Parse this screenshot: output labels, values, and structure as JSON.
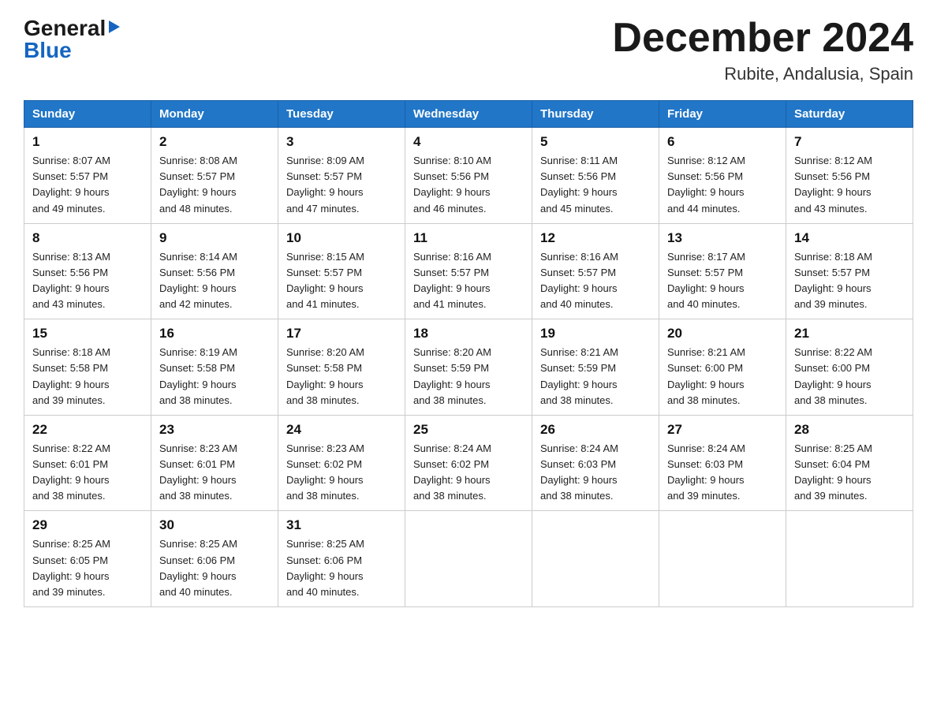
{
  "header": {
    "logo_line1": "General",
    "logo_line2": "Blue",
    "month_title": "December 2024",
    "location": "Rubite, Andalusia, Spain"
  },
  "days_of_week": [
    "Sunday",
    "Monday",
    "Tuesday",
    "Wednesday",
    "Thursday",
    "Friday",
    "Saturday"
  ],
  "weeks": [
    [
      {
        "num": "1",
        "sunrise": "8:07 AM",
        "sunset": "5:57 PM",
        "daylight": "9 hours and 49 minutes."
      },
      {
        "num": "2",
        "sunrise": "8:08 AM",
        "sunset": "5:57 PM",
        "daylight": "9 hours and 48 minutes."
      },
      {
        "num": "3",
        "sunrise": "8:09 AM",
        "sunset": "5:57 PM",
        "daylight": "9 hours and 47 minutes."
      },
      {
        "num": "4",
        "sunrise": "8:10 AM",
        "sunset": "5:56 PM",
        "daylight": "9 hours and 46 minutes."
      },
      {
        "num": "5",
        "sunrise": "8:11 AM",
        "sunset": "5:56 PM",
        "daylight": "9 hours and 45 minutes."
      },
      {
        "num": "6",
        "sunrise": "8:12 AM",
        "sunset": "5:56 PM",
        "daylight": "9 hours and 44 minutes."
      },
      {
        "num": "7",
        "sunrise": "8:12 AM",
        "sunset": "5:56 PM",
        "daylight": "9 hours and 43 minutes."
      }
    ],
    [
      {
        "num": "8",
        "sunrise": "8:13 AM",
        "sunset": "5:56 PM",
        "daylight": "9 hours and 43 minutes."
      },
      {
        "num": "9",
        "sunrise": "8:14 AM",
        "sunset": "5:56 PM",
        "daylight": "9 hours and 42 minutes."
      },
      {
        "num": "10",
        "sunrise": "8:15 AM",
        "sunset": "5:57 PM",
        "daylight": "9 hours and 41 minutes."
      },
      {
        "num": "11",
        "sunrise": "8:16 AM",
        "sunset": "5:57 PM",
        "daylight": "9 hours and 41 minutes."
      },
      {
        "num": "12",
        "sunrise": "8:16 AM",
        "sunset": "5:57 PM",
        "daylight": "9 hours and 40 minutes."
      },
      {
        "num": "13",
        "sunrise": "8:17 AM",
        "sunset": "5:57 PM",
        "daylight": "9 hours and 40 minutes."
      },
      {
        "num": "14",
        "sunrise": "8:18 AM",
        "sunset": "5:57 PM",
        "daylight": "9 hours and 39 minutes."
      }
    ],
    [
      {
        "num": "15",
        "sunrise": "8:18 AM",
        "sunset": "5:58 PM",
        "daylight": "9 hours and 39 minutes."
      },
      {
        "num": "16",
        "sunrise": "8:19 AM",
        "sunset": "5:58 PM",
        "daylight": "9 hours and 38 minutes."
      },
      {
        "num": "17",
        "sunrise": "8:20 AM",
        "sunset": "5:58 PM",
        "daylight": "9 hours and 38 minutes."
      },
      {
        "num": "18",
        "sunrise": "8:20 AM",
        "sunset": "5:59 PM",
        "daylight": "9 hours and 38 minutes."
      },
      {
        "num": "19",
        "sunrise": "8:21 AM",
        "sunset": "5:59 PM",
        "daylight": "9 hours and 38 minutes."
      },
      {
        "num": "20",
        "sunrise": "8:21 AM",
        "sunset": "6:00 PM",
        "daylight": "9 hours and 38 minutes."
      },
      {
        "num": "21",
        "sunrise": "8:22 AM",
        "sunset": "6:00 PM",
        "daylight": "9 hours and 38 minutes."
      }
    ],
    [
      {
        "num": "22",
        "sunrise": "8:22 AM",
        "sunset": "6:01 PM",
        "daylight": "9 hours and 38 minutes."
      },
      {
        "num": "23",
        "sunrise": "8:23 AM",
        "sunset": "6:01 PM",
        "daylight": "9 hours and 38 minutes."
      },
      {
        "num": "24",
        "sunrise": "8:23 AM",
        "sunset": "6:02 PM",
        "daylight": "9 hours and 38 minutes."
      },
      {
        "num": "25",
        "sunrise": "8:24 AM",
        "sunset": "6:02 PM",
        "daylight": "9 hours and 38 minutes."
      },
      {
        "num": "26",
        "sunrise": "8:24 AM",
        "sunset": "6:03 PM",
        "daylight": "9 hours and 38 minutes."
      },
      {
        "num": "27",
        "sunrise": "8:24 AM",
        "sunset": "6:03 PM",
        "daylight": "9 hours and 39 minutes."
      },
      {
        "num": "28",
        "sunrise": "8:25 AM",
        "sunset": "6:04 PM",
        "daylight": "9 hours and 39 minutes."
      }
    ],
    [
      {
        "num": "29",
        "sunrise": "8:25 AM",
        "sunset": "6:05 PM",
        "daylight": "9 hours and 39 minutes."
      },
      {
        "num": "30",
        "sunrise": "8:25 AM",
        "sunset": "6:06 PM",
        "daylight": "9 hours and 40 minutes."
      },
      {
        "num": "31",
        "sunrise": "8:25 AM",
        "sunset": "6:06 PM",
        "daylight": "9 hours and 40 minutes."
      },
      null,
      null,
      null,
      null
    ]
  ],
  "labels": {
    "sunrise": "Sunrise:",
    "sunset": "Sunset:",
    "daylight": "Daylight:"
  }
}
